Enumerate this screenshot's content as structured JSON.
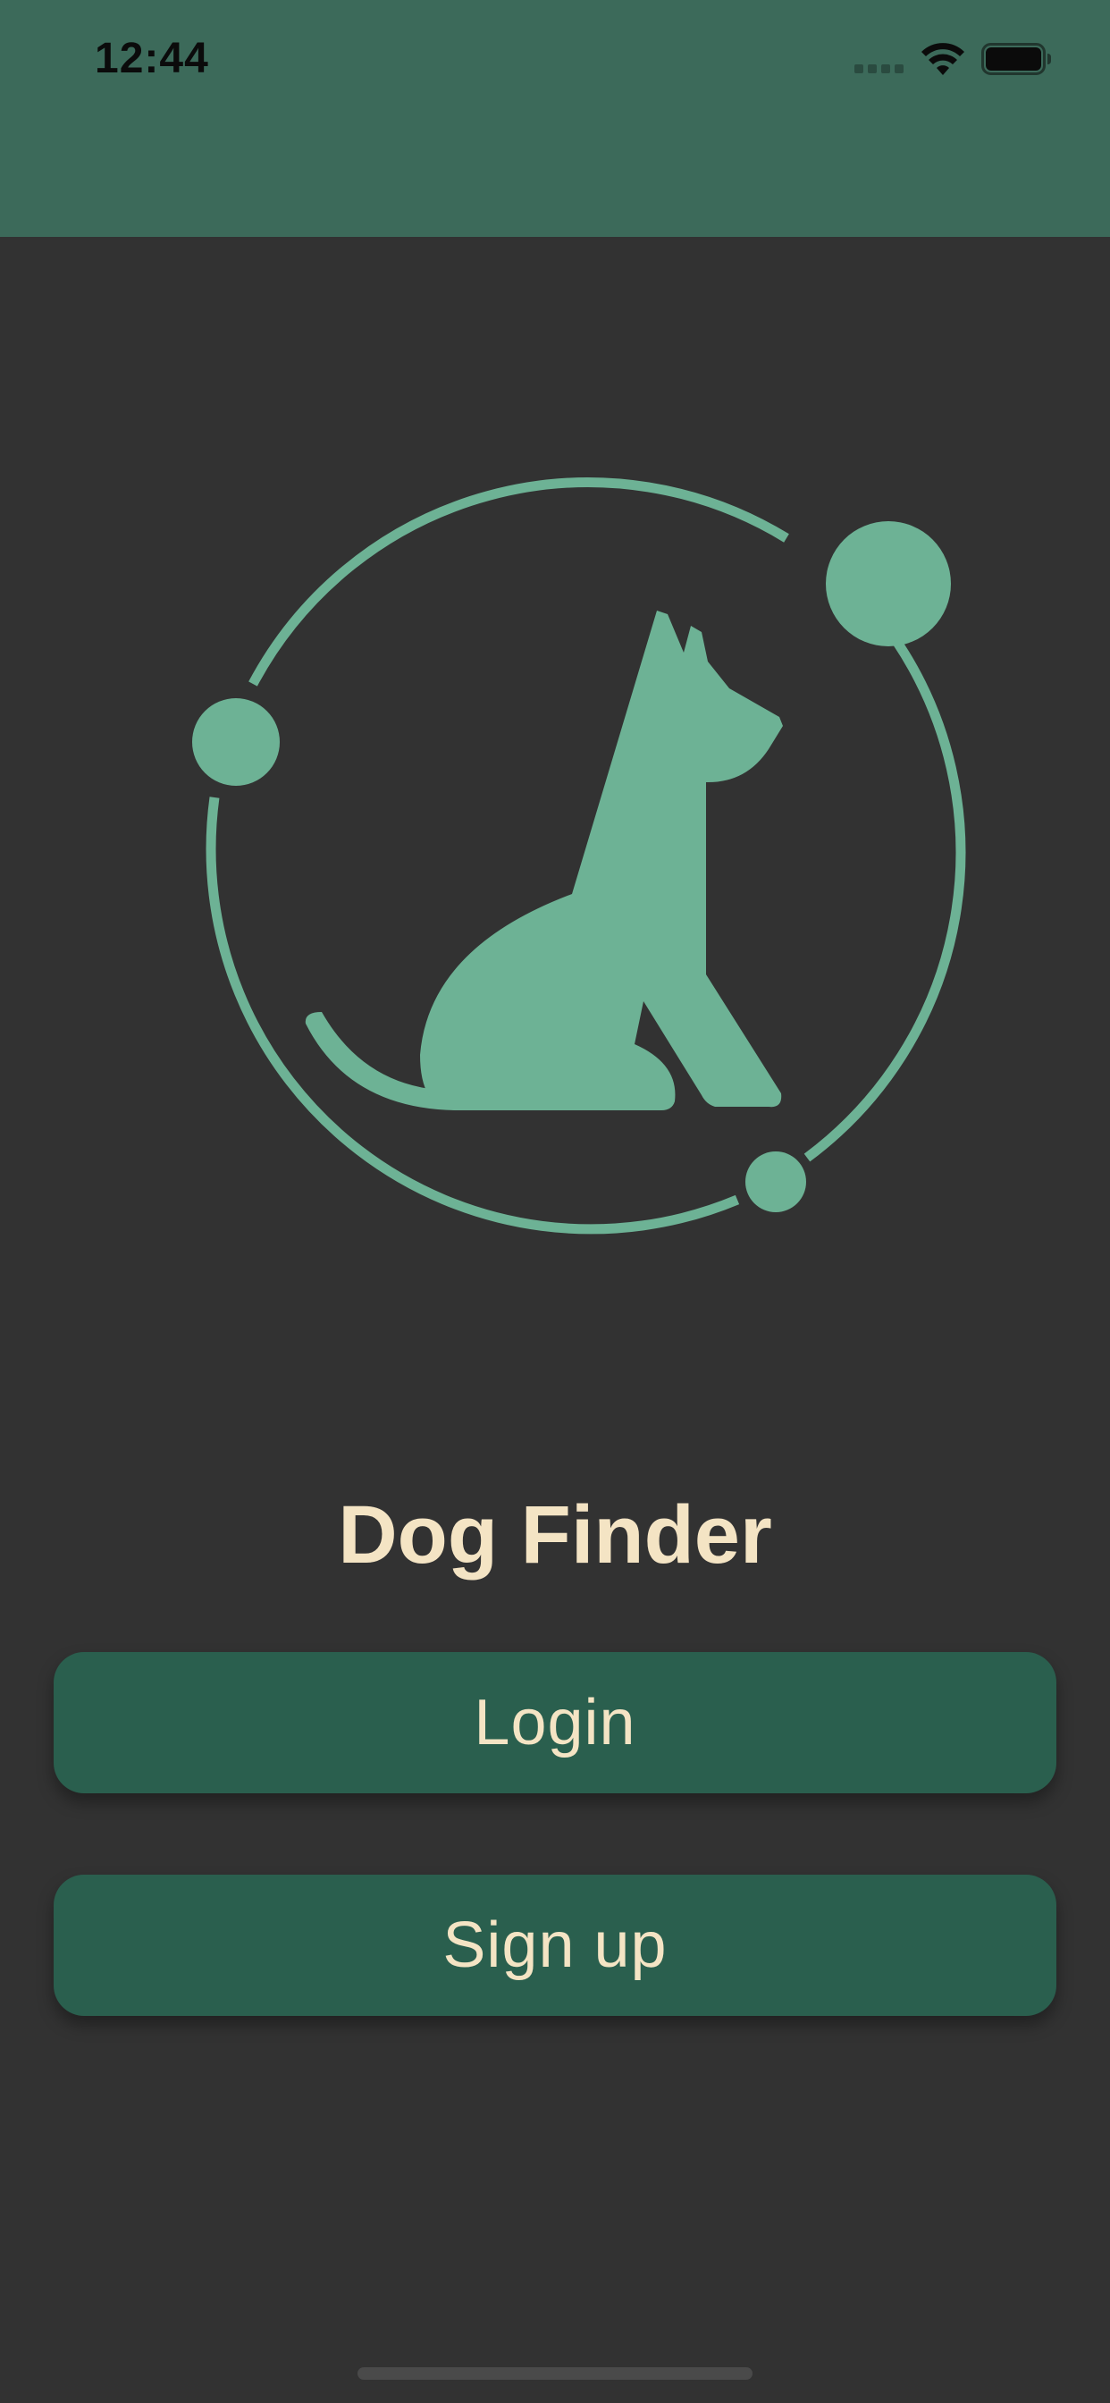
{
  "status_bar": {
    "time": "12:44",
    "signal_icon": "cellular-signal-icon",
    "wifi_icon": "wifi-icon",
    "battery_icon": "battery-full-icon"
  },
  "logo": {
    "icon": "dog-orbit-logo-icon",
    "color": "#6db295"
  },
  "app": {
    "title": "Dog Finder"
  },
  "actions": {
    "login_label": "Login",
    "signup_label": "Sign up"
  },
  "colors": {
    "header": "#3c6a5a",
    "background": "#323232",
    "button": "#2a5f4e",
    "text": "#f4e4c4",
    "accent": "#6db295"
  }
}
